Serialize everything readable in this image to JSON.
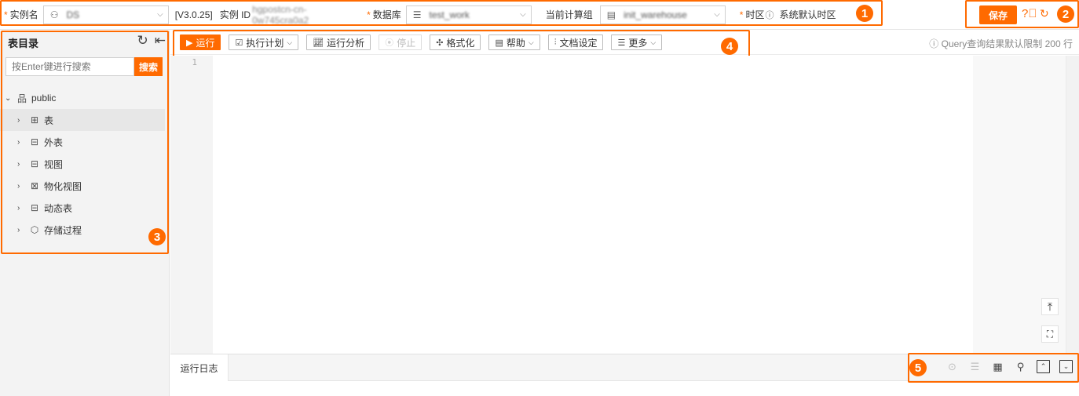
{
  "config": {
    "instance_label": "实例名",
    "instance_value": "DS",
    "version": "[V3.0.25]",
    "instance_id_label": "实例 ID",
    "instance_id_value": "hgpostcn-cn-0w745cra0a2",
    "database_label": "数据库",
    "database_value": "test_work",
    "warehouse_label": "当前计算组",
    "warehouse_value": "init_warehouse",
    "timezone_label": "时区",
    "timezone_value": "系统默认时区"
  },
  "actions": {
    "save_label": "保存"
  },
  "sidebar": {
    "title": "表目录",
    "search_placeholder": "按Enter键进行搜索",
    "search_button": "搜索",
    "root": "public",
    "items": [
      {
        "label": "表",
        "icon": "table-icon"
      },
      {
        "label": "外表",
        "icon": "foreign-table-icon"
      },
      {
        "label": "视图",
        "icon": "view-icon"
      },
      {
        "label": "物化视图",
        "icon": "materialized-view-icon"
      },
      {
        "label": "动态表",
        "icon": "dynamic-table-icon"
      },
      {
        "label": "存储过程",
        "icon": "procedure-icon"
      }
    ]
  },
  "toolbar": {
    "run": "运行",
    "explain": "执行计划",
    "analyze": "运行分析",
    "stop": "停止",
    "format": "格式化",
    "help": "帮助",
    "settings": "文档设定",
    "more": "更多",
    "limit_note": "Query查询结果默认限制 200 行"
  },
  "editor": {
    "line_number": "1"
  },
  "log": {
    "tab_label": "运行日志"
  },
  "annotations": [
    "1",
    "2",
    "3",
    "4",
    "5"
  ],
  "colors": {
    "accent": "#ff6a00"
  }
}
